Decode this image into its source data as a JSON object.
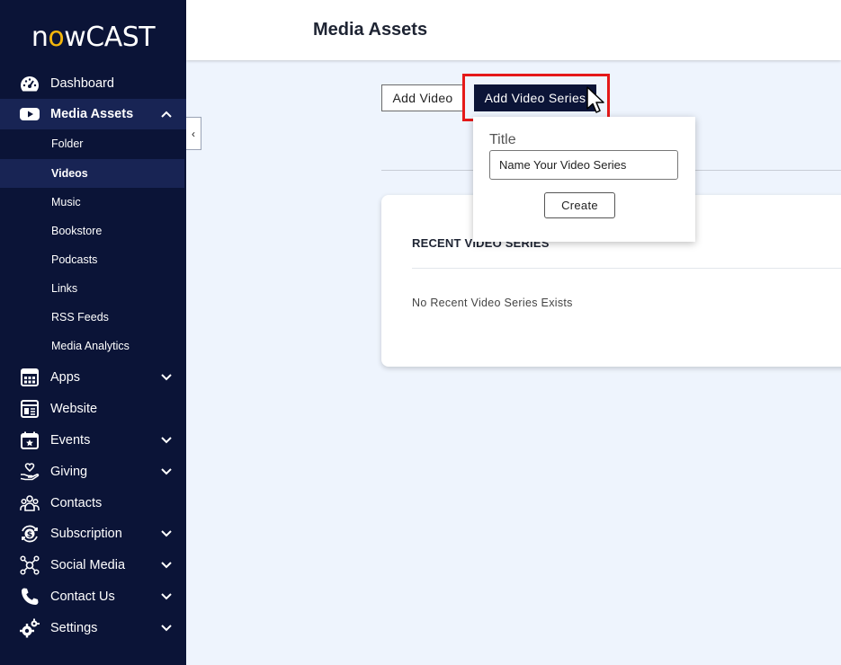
{
  "app": {
    "logo_text_left": "n",
    "logo_text_o": "o",
    "logo_text_right": "wCAST"
  },
  "header": {
    "title": "Media Assets"
  },
  "sidebar": {
    "items": [
      {
        "label": "Dashboard",
        "icon": "gauge-icon"
      },
      {
        "label": "Media Assets",
        "icon": "play-icon",
        "expanded": true
      },
      {
        "label": "Apps",
        "icon": "apps-icon"
      },
      {
        "label": "Website",
        "icon": "website-icon"
      },
      {
        "label": "Events",
        "icon": "calendar-star-icon"
      },
      {
        "label": "Giving",
        "icon": "hand-heart-icon"
      },
      {
        "label": "Contacts",
        "icon": "people-icon"
      },
      {
        "label": "Subscription",
        "icon": "dollar-cycle-icon"
      },
      {
        "label": "Social Media",
        "icon": "network-icon"
      },
      {
        "label": "Contact Us",
        "icon": "phone-icon"
      },
      {
        "label": "Settings",
        "icon": "gear-icon"
      }
    ],
    "media_sub": [
      "Folder",
      "Videos",
      "Music",
      "Bookstore",
      "Podcasts",
      "Links",
      "RSS Feeds",
      "Media Analytics"
    ],
    "active_sub": "Videos"
  },
  "toolbar": {
    "add_video": "Add Video",
    "add_video_series": "Add Video Series"
  },
  "popover": {
    "label": "Title",
    "input_value": "Name Your Video Series",
    "create": "Create"
  },
  "card": {
    "title": "RECENT VIDEO SERIES",
    "empty": "No Recent Video Series Exists"
  },
  "colors": {
    "sidebar_bg": "#0b1437",
    "accent": "#f3b60c",
    "highlight": "#e51919",
    "page_bg": "#eef4fd"
  }
}
